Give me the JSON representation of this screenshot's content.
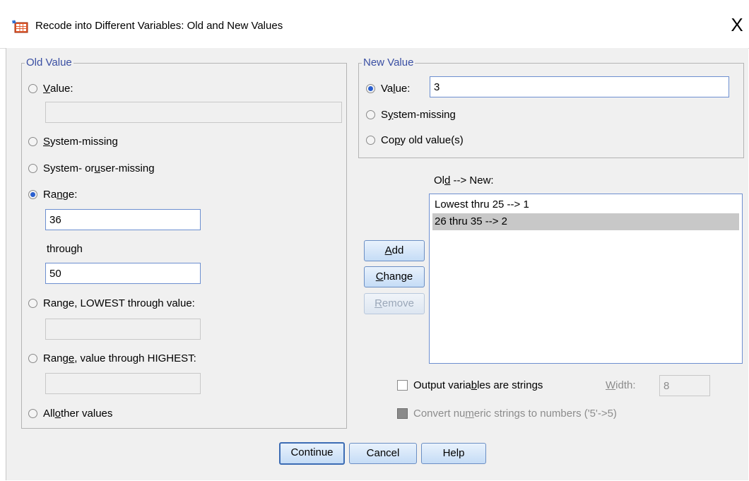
{
  "window": {
    "title": "Recode into Different Variables: Old and New Values",
    "close_glyph": "X",
    "icon": "recode-icon"
  },
  "old_value": {
    "legend": "Old Value",
    "value_radio": {
      "pre": "",
      "u": "V",
      "post": "alue:",
      "selected": false
    },
    "value_field": "",
    "system_missing": {
      "pre": "",
      "u": "S",
      "post": "ystem-missing",
      "selected": false
    },
    "system_or_user_missing": {
      "pre": "System- or ",
      "u": "u",
      "post": "ser-missing",
      "selected": false
    },
    "range": {
      "pre": "Ra",
      "u": "n",
      "post": "ge:",
      "selected": true
    },
    "range_from": "36",
    "through_label": "through",
    "range_to": "50",
    "range_lowest": {
      "pre": "Range, LOWEST through value:",
      "u": "",
      "post": "",
      "selected": false
    },
    "range_lowest_field": "",
    "range_highest": {
      "pre": "Rang",
      "u": "e",
      "post": ", value through HIGHEST:",
      "selected": false
    },
    "range_highest_field": "",
    "all_other": {
      "pre": "All ",
      "u": "o",
      "post": "ther values",
      "selected": false
    }
  },
  "new_value": {
    "legend": "New Value",
    "value_radio": {
      "pre": "Va",
      "u": "l",
      "post": "ue:",
      "selected": true
    },
    "value_field": "3",
    "system_missing": {
      "pre": "S",
      "u": "y",
      "post": "stem-missing",
      "selected": false
    },
    "copy_old": {
      "pre": "Co",
      "u": "p",
      "post": "y old value(s)",
      "selected": false
    }
  },
  "mapping": {
    "label_pre": "Ol",
    "label_u": "d",
    "label_post": " --> New:",
    "items": [
      {
        "text": "Lowest thru 25 --> 1",
        "selected": false
      },
      {
        "text": "26 thru 35 --> 2",
        "selected": true
      }
    ],
    "add": {
      "u": "A",
      "post": "dd"
    },
    "change": {
      "u": "C",
      "post": "hange"
    },
    "remove": {
      "u": "R",
      "post": "emove",
      "enabled": false
    }
  },
  "options": {
    "output_strings": {
      "pre": "Output varia",
      "u": "b",
      "post": "les are strings",
      "checked": false
    },
    "width_label": {
      "u": "W",
      "post": "idth:"
    },
    "width_value": "8",
    "convert_numeric": {
      "pre": "Convert nu",
      "u": "m",
      "post": "eric strings to numbers ('5'->5)",
      "checked": false,
      "enabled": false
    }
  },
  "buttons": {
    "continue": "Continue",
    "cancel": "Cancel",
    "help": "Help"
  }
}
